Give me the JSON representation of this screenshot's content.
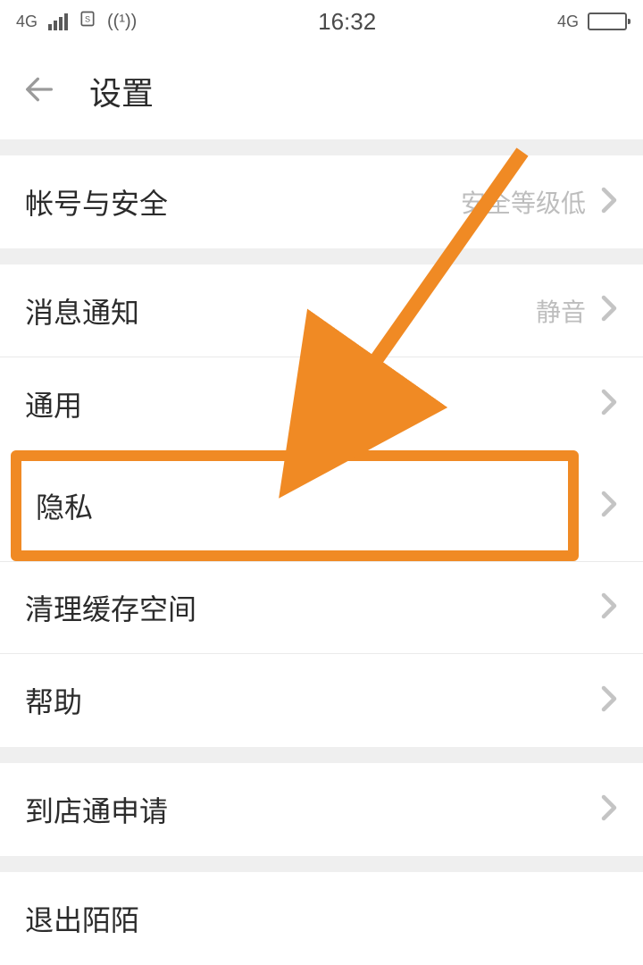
{
  "status": {
    "network": "4G",
    "time": "16:32",
    "right_network": "4G"
  },
  "header": {
    "title": "设置"
  },
  "rows": {
    "account": {
      "label": "帐号与安全",
      "value": "安全等级低"
    },
    "notify": {
      "label": "消息通知",
      "value": "静音"
    },
    "general": {
      "label": "通用"
    },
    "privacy": {
      "label": "隐私"
    },
    "cache": {
      "label": "清理缓存空间"
    },
    "help": {
      "label": "帮助"
    },
    "shop": {
      "label": "到店通申请"
    },
    "logout": {
      "label": "退出陌陌"
    }
  }
}
